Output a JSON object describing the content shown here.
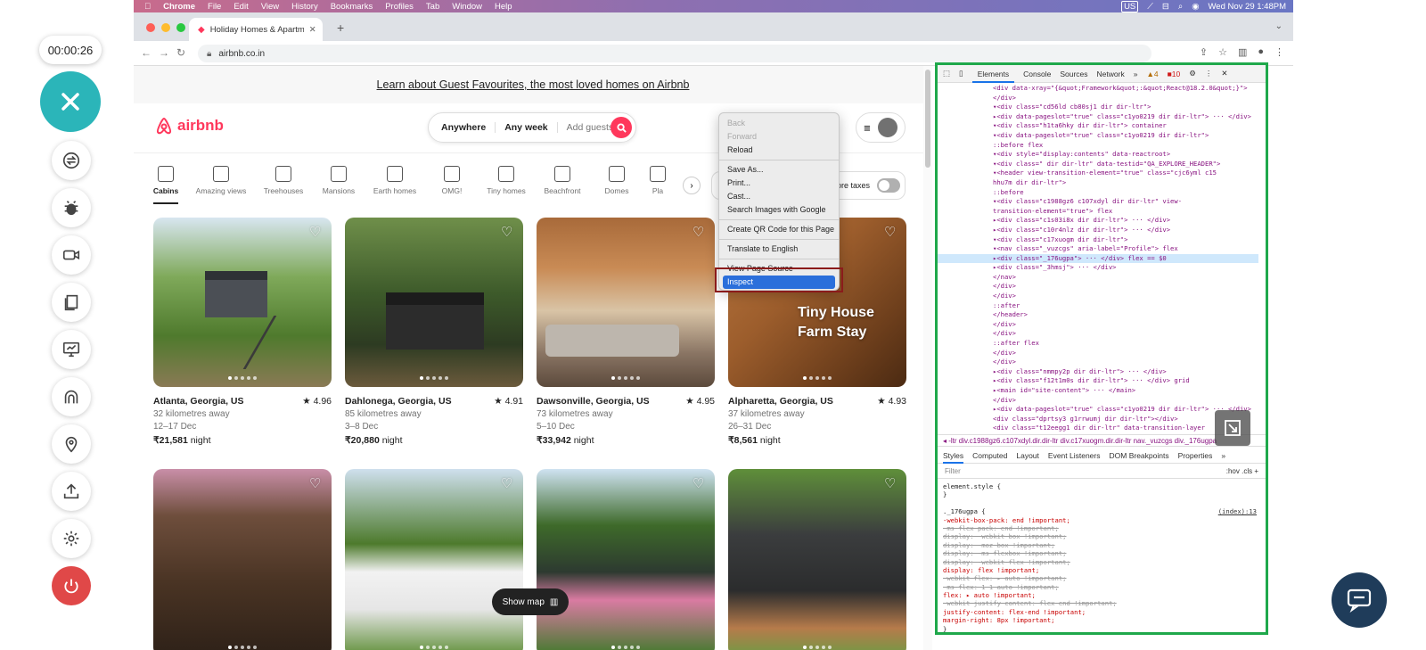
{
  "recorder": {
    "timer": "00:00:26"
  },
  "menubar": {
    "apple": "",
    "items": [
      "Chrome",
      "File",
      "Edit",
      "View",
      "History",
      "Bookmarks",
      "Profiles",
      "Tab",
      "Window",
      "Help"
    ],
    "input_lang": "US",
    "datetime": "Wed Nov 29  1:48PM"
  },
  "browser": {
    "tab_title": "Holiday Homes & Apartment R...",
    "url": "airbnb.co.in"
  },
  "page": {
    "banner": "Learn about Guest Favourites, the most loved homes on Airbnb",
    "logo": "airbnb",
    "search": {
      "where": "Anywhere",
      "when": "Any week",
      "guests": "Add guests"
    },
    "categories": [
      "Cabins",
      "Amazing views",
      "Treehouses",
      "Mansions",
      "Earth homes",
      "OMG!",
      "Tiny homes",
      "Beachfront",
      "Domes",
      "Pla"
    ],
    "taxes_label": "ore taxes",
    "listings": [
      {
        "title": "Atlanta, Georgia, US",
        "rating": "4.96",
        "distance": "32 kilometres away",
        "dates": "12–17 Dec",
        "price": "₹21,581",
        "unit": "night"
      },
      {
        "title": "Dahlonega, Georgia, US",
        "rating": "4.91",
        "distance": "85 kilometres away",
        "dates": "3–8 Dec",
        "price": "₹20,880",
        "unit": "night"
      },
      {
        "title": "Dawsonville, Georgia, US",
        "rating": "4.95",
        "distance": "73 kilometres away",
        "dates": "5–10 Dec",
        "price": "₹33,942",
        "unit": "night"
      },
      {
        "title": "Alpharetta, Georgia, US",
        "rating": "4.93",
        "distance": "37 kilometres away",
        "dates": "26–31 Dec",
        "price": "₹8,561",
        "unit": "night"
      }
    ],
    "photo_overlay": "Tiny House Farm Stay",
    "show_map": "Show map"
  },
  "context_menu": {
    "items": [
      {
        "label": "Back",
        "disabled": true
      },
      {
        "label": "Forward",
        "disabled": true
      },
      {
        "label": "Reload"
      },
      {
        "sep": true
      },
      {
        "label": "Save As..."
      },
      {
        "label": "Print..."
      },
      {
        "label": "Cast..."
      },
      {
        "label": "Search Images with Google"
      },
      {
        "sep": true
      },
      {
        "label": "Create QR Code for this Page"
      },
      {
        "sep": true
      },
      {
        "label": "Translate to English"
      },
      {
        "sep": true
      },
      {
        "label": "View Page Source"
      },
      {
        "label": "Inspect",
        "highlight": true
      }
    ]
  },
  "devtools": {
    "tabs": [
      "Elements",
      "Console",
      "Sources",
      "Network",
      "»"
    ],
    "warnings": "4",
    "errors": "10",
    "tree": [
      "<div data-xray=\"{&quot;Framework&quot;:&quot;React@18.2.0&quot;}\">",
      "</div>",
      "▾<div class=\"cd56ld cb80sj1 dir dir-ltr\">",
      "  ▸<div data-pageslot=\"true\" class=\"c1yo0219 dir dir-ltr\"> ··· </div>",
      "  ▾<div class=\"h1ta6hky dir dir-ltr\"> container",
      "    ▾<div data-pageslot=\"true\" class=\"c1yo0219 dir dir-ltr\">",
      "       ::before flex",
      "      ▾<div style=\"display:contents\" data-reactroot>",
      "        ▾<div class=\" dir dir-ltr\" data-testid=\"QA_EXPLORE_HEADER\">",
      "          ▾<header view-transition-element=\"true\" class=\"cjc6yml c15",
      "            hhu7m dir dir-ltr\">",
      "              ::before",
      "            ▾<div class=\"c1988gz6 c107xdyl dir dir-ltr\" view-",
      "              transition-element=\"true\"> flex",
      "              ▸<div class=\"c1s03i8x dir dir-ltr\"> ··· </div>",
      "              ▸<div class=\"c10r4nlz dir dir-ltr\"> ··· </div>",
      "              ▾<div class=\"c17xuogm dir dir-ltr\">",
      "                ▾<nav class=\"_vuzcgs\" aria-label=\"Profile\"> flex",
      "                  ▸<div class=\"_176ugpa\"> ··· </div> flex == $0",
      "                  ▸<div class=\"_3hmsj\"> ··· </div>",
      "                  </nav>",
      "                </div>",
      "              </div>",
      "              ::after",
      "            </header>",
      "          </div>",
      "        </div>",
      "         ::after flex",
      "      </div>",
      "    </div>",
      "  ▸<div class=\"nmmpy2p dir dir-ltr\"> ··· </div>",
      "  ▸<div class=\"f12t1m0s dir dir-ltr\"> ··· </div> grid",
      "  ▸<main id=\"site-content\"> ··· </main>",
      "  </div>",
      "▸<div data-pageslot=\"true\" class=\"c1yo0219 dir dir-ltr\"> ··· </div>",
      " <div class=\"dprtsy3 g1rrwumj dir dir-ltr\"></div>",
      " <div class=\"t12eegg1 dir dir-ltr\" data-transition-layer"
    ],
    "breadcrumb": "◂ -ltr   div.c1988gz6.c107xdyl.dir.dir-ltr   div.c17xuogm.dir.dir-ltr   nav._vuzcgs   div._176ugpa",
    "style_tabs": [
      "Styles",
      "Computed",
      "Layout",
      "Event Listeners",
      "DOM Breakpoints",
      "Properties",
      "»"
    ],
    "filter_placeholder": "Filter",
    "filter_right": ":hov  .cls  +",
    "css": [
      {
        "t": "element.style {",
        "k": "sel"
      },
      {
        "t": "}",
        "k": "sel"
      },
      {
        "t": "",
        "k": "sel"
      },
      {
        "t": "._176ugpa {",
        "k": "sel",
        "idx": "(index):13"
      },
      {
        "t": "  -webkit-box-pack: end !important;",
        "k": "p"
      },
      {
        "t": "  -ms-flex-pack: end !important;",
        "k": "s"
      },
      {
        "t": "  display: -webkit-box !important;",
        "k": "s"
      },
      {
        "t": "  display: -moz-box !important;",
        "k": "s"
      },
      {
        "t": "  display: -ms-flexbox !important;",
        "k": "s"
      },
      {
        "t": "  display: -webkit-flex !important;",
        "k": "s"
      },
      {
        "t": "  display: flex !important;",
        "k": "p"
      },
      {
        "t": "  -webkit-flex: ▸ auto !important;",
        "k": "s"
      },
      {
        "t": "  -ms-flex: 1 1 auto !important;",
        "k": "s"
      },
      {
        "t": "  flex: ▸ auto !important;",
        "k": "p"
      },
      {
        "t": "  -webkit-justify-content: flex-end !important;",
        "k": "s"
      },
      {
        "t": "  justify-content: flex-end !important;",
        "k": "p"
      },
      {
        "t": "  margin-right: 8px !important;",
        "k": "p"
      },
      {
        "t": "}",
        "k": "sel"
      }
    ]
  }
}
